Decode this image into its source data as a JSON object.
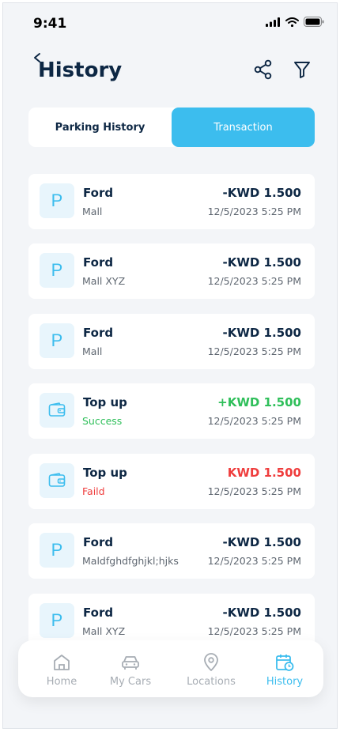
{
  "status_bar": {
    "time": "9:41"
  },
  "header": {
    "title": "History"
  },
  "tabs": [
    {
      "label": "Parking History",
      "active": false
    },
    {
      "label": "Transaction",
      "active": true
    }
  ],
  "transactions": [
    {
      "type": "parking",
      "title": "Ford",
      "subtitle": "Mall",
      "amount": "-KWD 1.500",
      "date": "12/5/2023 5:25 PM"
    },
    {
      "type": "parking",
      "title": "Ford",
      "subtitle": "Mall XYZ",
      "amount": "-KWD 1.500",
      "date": "12/5/2023 5:25 PM"
    },
    {
      "type": "parking",
      "title": "Ford",
      "subtitle": "Mall",
      "amount": "-KWD 1.500",
      "date": "12/5/2023 5:25 PM"
    },
    {
      "type": "topup",
      "title": "Top up",
      "subtitle": "Success",
      "amount": "+KWD 1.500",
      "date": "12/5/2023 5:25 PM"
    },
    {
      "type": "topup",
      "title": "Top up",
      "subtitle": "Faild",
      "amount": "KWD 1.500",
      "date": "12/5/2023 5:25 PM"
    },
    {
      "type": "parking",
      "title": "Ford",
      "subtitle": "Maldfghdfghjkl;hjks",
      "amount": "-KWD 1.500",
      "date": "12/5/2023 5:25 PM"
    },
    {
      "type": "parking",
      "title": "Ford",
      "subtitle": "Mall XYZ",
      "amount": "-KWD 1.500",
      "date": "12/5/2023 5:25 PM"
    }
  ],
  "parking_icon_letter": "P",
  "colors": {
    "accent": "#3cbdee",
    "success": "#2fbf5a",
    "failed": "#ef3d3d",
    "text": "#0d2744"
  },
  "nav": [
    {
      "label": "Home",
      "icon": "home-icon",
      "active": false
    },
    {
      "label": "My Cars",
      "icon": "car-icon",
      "active": false
    },
    {
      "label": "Locations",
      "icon": "location-pin-icon",
      "active": false
    },
    {
      "label": "History",
      "icon": "calendar-clock-icon",
      "active": true
    }
  ]
}
